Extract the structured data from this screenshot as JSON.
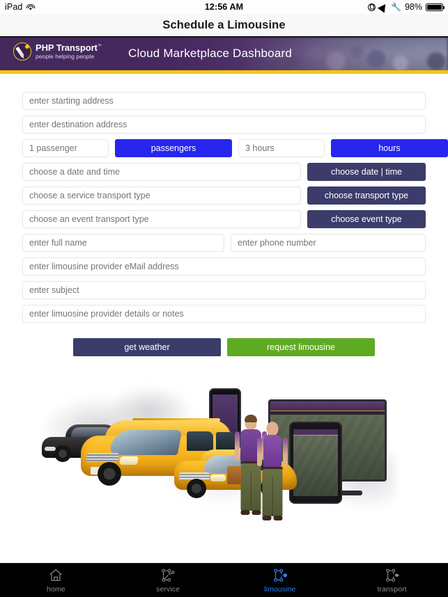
{
  "status_bar": {
    "device": "iPad",
    "wifi_icon": "wifi-icon",
    "time": "12:56 AM",
    "lock_icon": "rotation-lock-icon",
    "location_icon": "location-arrow-icon",
    "bluetooth_icon": "bluetooth-icon",
    "battery_percent": "98%",
    "battery_icon": "battery-icon"
  },
  "nav": {
    "title": "Schedule a Limousine"
  },
  "banner": {
    "logo_name": "PHP Transport",
    "logo_tm": "™",
    "logo_tagline": "people helping people",
    "logo_icon": "php-transport-logo-icon",
    "title": "Cloud Marketplace Dashboard",
    "purple": "#4a2b63",
    "gold": "#f3c413"
  },
  "form": {
    "starting_address_placeholder": "enter starting address",
    "destination_address_placeholder": "enter destination address",
    "passengers_value_placeholder": "1 passenger",
    "passengers_button": "passengers",
    "hours_value_placeholder": "3 hours",
    "hours_button": "hours",
    "date_placeholder": "choose a date and time",
    "date_button": "choose date | time",
    "service_placeholder": "choose a service transport type",
    "service_button": "choose transport type",
    "event_placeholder": "choose an event transport type",
    "event_button": "choose event type",
    "full_name_placeholder": "enter full name",
    "phone_placeholder": "enter phone number",
    "email_placeholder": "enter limousine provider eMail address",
    "subject_placeholder": "enter subject",
    "notes_placeholder": "enter limuosine provider details or notes",
    "blue": "#2626ee",
    "navy": "#3b3c6a"
  },
  "actions": {
    "get_weather": "get weather",
    "request_limousine": "request limousine",
    "navy": "#3b3c6a",
    "green": "#5faa23"
  },
  "hero": {
    "alt": "yellow taxi van, sedan, black car, two people, phone tablet and monitor showing PHP Transport Mobility Management Planner"
  },
  "tabbar": {
    "items": [
      {
        "label": "home",
        "icon": "home-icon",
        "active": false
      },
      {
        "label": "service",
        "icon": "service-network-icon",
        "active": false
      },
      {
        "label": "limousine",
        "icon": "limousine-network-icon",
        "active": true
      },
      {
        "label": "transport",
        "icon": "transport-network-icon",
        "active": false
      }
    ],
    "active_color": "#2b7cf0",
    "inactive_color": "#8e8e93"
  }
}
